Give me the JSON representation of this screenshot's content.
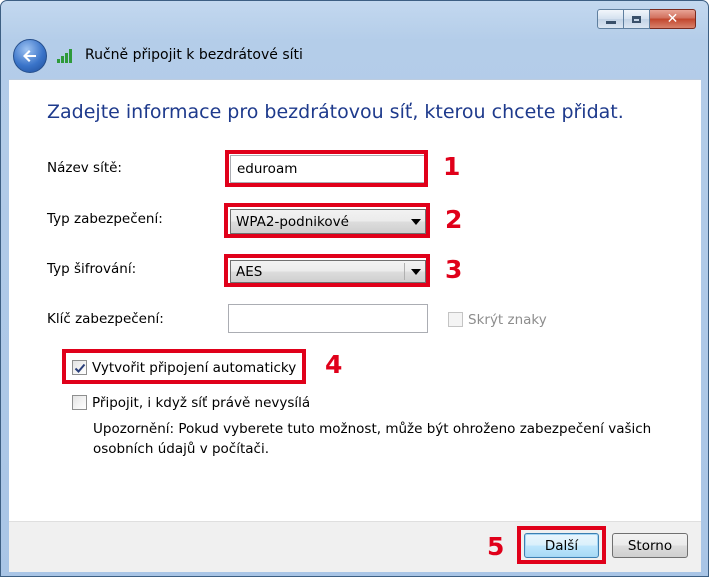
{
  "window": {
    "nav_title": "Ručně připojit k bezdrátové síti"
  },
  "main": {
    "heading": "Zadejte informace pro bezdrátovou síť, kterou chcete přidat.",
    "network_name": {
      "label": "Název sítě:",
      "value": "eduroam"
    },
    "security_type": {
      "label": "Typ zabezpečení:",
      "value": "WPA2-podnikové"
    },
    "encryption_type": {
      "label": "Typ šifrování:",
      "value": "AES"
    },
    "security_key": {
      "label": "Klíč zabezpečení:",
      "value": ""
    },
    "hide_chars": {
      "label": "Skrýt znaky",
      "checked": false,
      "disabled": true
    },
    "auto_connect": {
      "label": "Vytvořit připojení automaticky",
      "checked": true
    },
    "connect_hidden": {
      "label": "Připojit, i když síť právě nevysílá",
      "checked": false
    },
    "warning": "Upozornění: Pokud vyberete tuto možnost, může být ohroženo zabezpečení vašich osobních údajů v počítači."
  },
  "annotations": {
    "n1": "1",
    "n2": "2",
    "n3": "3",
    "n4": "4",
    "n5": "5",
    "color": "#e0001a"
  },
  "footer": {
    "next_label": "Další",
    "cancel_label": "Storno"
  },
  "colors": {
    "heading": "#1e3a8c",
    "frame": "#b4cde9",
    "close_button": "#c2462d"
  }
}
